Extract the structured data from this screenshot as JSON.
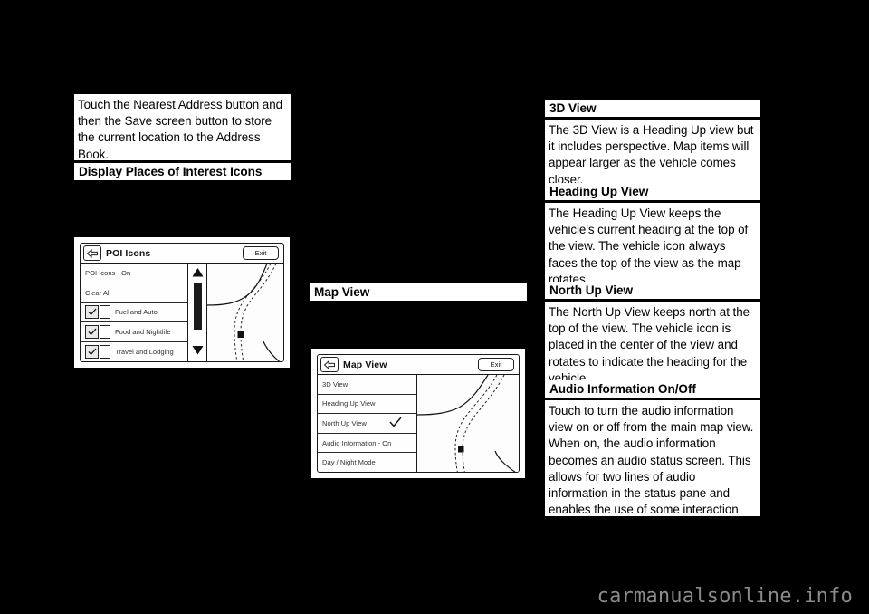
{
  "page": {
    "background_color": "#000000",
    "text_block_color": "#ffffff",
    "footer_watermark": "carmanualsonline.info"
  },
  "left_column": {
    "intro_paragraph": "Touch the Nearest Address button and then the Save screen button to store the current location to the Address Book.",
    "heading": "Display Places of Interest Icons",
    "poi_screen": {
      "title": "POI Icons",
      "back_icon": "back-arrow-icon",
      "exit_label": "Exit",
      "rows": [
        {
          "label": "POI Icons - On",
          "checkbox": false,
          "checked": false
        },
        {
          "label": "Clear All",
          "checkbox": false,
          "checked": false
        },
        {
          "label": "Fuel and Auto",
          "checkbox": true,
          "checked": true
        },
        {
          "label": "Food and Nightlife",
          "checkbox": true,
          "checked": true
        },
        {
          "label": "Travel and Lodging",
          "checkbox": true,
          "checked": true
        }
      ],
      "scrollbar": {
        "up_arrow": "scroll-up-arrow-icon",
        "down_arrow": "scroll-down-arrow-icon"
      }
    }
  },
  "middle_column": {
    "heading": "Map View",
    "map_view_screen": {
      "title": "Map View",
      "back_icon": "back-arrow-icon",
      "exit_label": "Exit",
      "rows": [
        {
          "label": "3D View",
          "selected": false
        },
        {
          "label": "Heading Up View",
          "selected": false
        },
        {
          "label": "North Up View",
          "selected": true
        },
        {
          "label": "Audio Information - On",
          "selected": false
        },
        {
          "label": "Day / Night Mode",
          "selected": false
        }
      ]
    }
  },
  "right_column": {
    "sections": [
      {
        "heading": "3D View",
        "body": "The 3D View is a Heading Up view but it includes perspective. Map items will appear larger as the vehicle comes closer."
      },
      {
        "heading": "Heading Up View",
        "body": "The Heading Up View keeps the vehicle's current heading at the top of the view. The vehicle icon always faces the top of the view as the map rotates."
      },
      {
        "heading": "North Up View",
        "body": "The North Up View keeps north at the top of the view. The vehicle icon is placed in the center of the view and rotates to indicate the heading for the vehicle."
      },
      {
        "heading": "Audio Information On/Off",
        "body": "Touch to turn the audio information view on or off from the main map view. When on, the audio information becomes an audio status screen. This allows for two lines of audio information in the status pane and enables the use of some interaction selector controls."
      }
    ]
  }
}
